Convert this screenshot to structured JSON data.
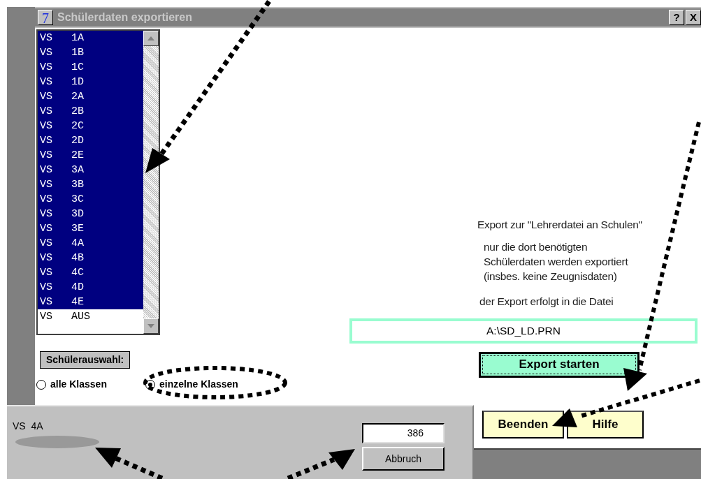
{
  "window": {
    "icon_text": "7",
    "title": "Schülerdaten exportieren",
    "help_button": "?",
    "close_button": "X"
  },
  "class_list": {
    "items": [
      {
        "label": "VS   1A",
        "selected": true
      },
      {
        "label": "VS   1B",
        "selected": true
      },
      {
        "label": "VS   1C",
        "selected": true
      },
      {
        "label": "VS   1D",
        "selected": true
      },
      {
        "label": "VS   2A",
        "selected": true
      },
      {
        "label": "VS   2B",
        "selected": true
      },
      {
        "label": "VS   2C",
        "selected": true
      },
      {
        "label": "VS   2D",
        "selected": true
      },
      {
        "label": "VS   2E",
        "selected": true
      },
      {
        "label": "VS   3A",
        "selected": true
      },
      {
        "label": "VS   3B",
        "selected": true
      },
      {
        "label": "VS   3C",
        "selected": true
      },
      {
        "label": "VS   3D",
        "selected": true
      },
      {
        "label": "VS   3E",
        "selected": true
      },
      {
        "label": "VS   4A",
        "selected": true
      },
      {
        "label": "VS   4B",
        "selected": true
      },
      {
        "label": "VS   4C",
        "selected": true
      },
      {
        "label": "VS   4D",
        "selected": true
      },
      {
        "label": "VS   4E",
        "selected": true
      },
      {
        "label": "VS   AUS",
        "selected": false
      }
    ]
  },
  "selection": {
    "label": "Schülerauswahl:",
    "options": [
      {
        "label": "alle Klassen",
        "selected": false
      },
      {
        "label": "einzelne Klassen",
        "selected": true
      }
    ]
  },
  "info": {
    "heading": "Export zur \"Lehrerdatei an Schulen\"",
    "note_lines": [
      "nur die dort benötigten",
      "Schülerdaten werden exportiert",
      "(insbes. keine Zeugnisdaten)"
    ],
    "target_label": "der Export erfolgt in die Datei",
    "file_path": "A:\\SD_LD.PRN"
  },
  "buttons": [
    {
      "label": "Export starten",
      "kind": "primary"
    },
    {
      "label": "Beenden",
      "kind": "secondary"
    },
    {
      "label": "Hilfe",
      "kind": "secondary"
    }
  ],
  "progress": {
    "current_class": "VS  4A",
    "count": "386",
    "cancel_button": "Abbruch"
  }
}
